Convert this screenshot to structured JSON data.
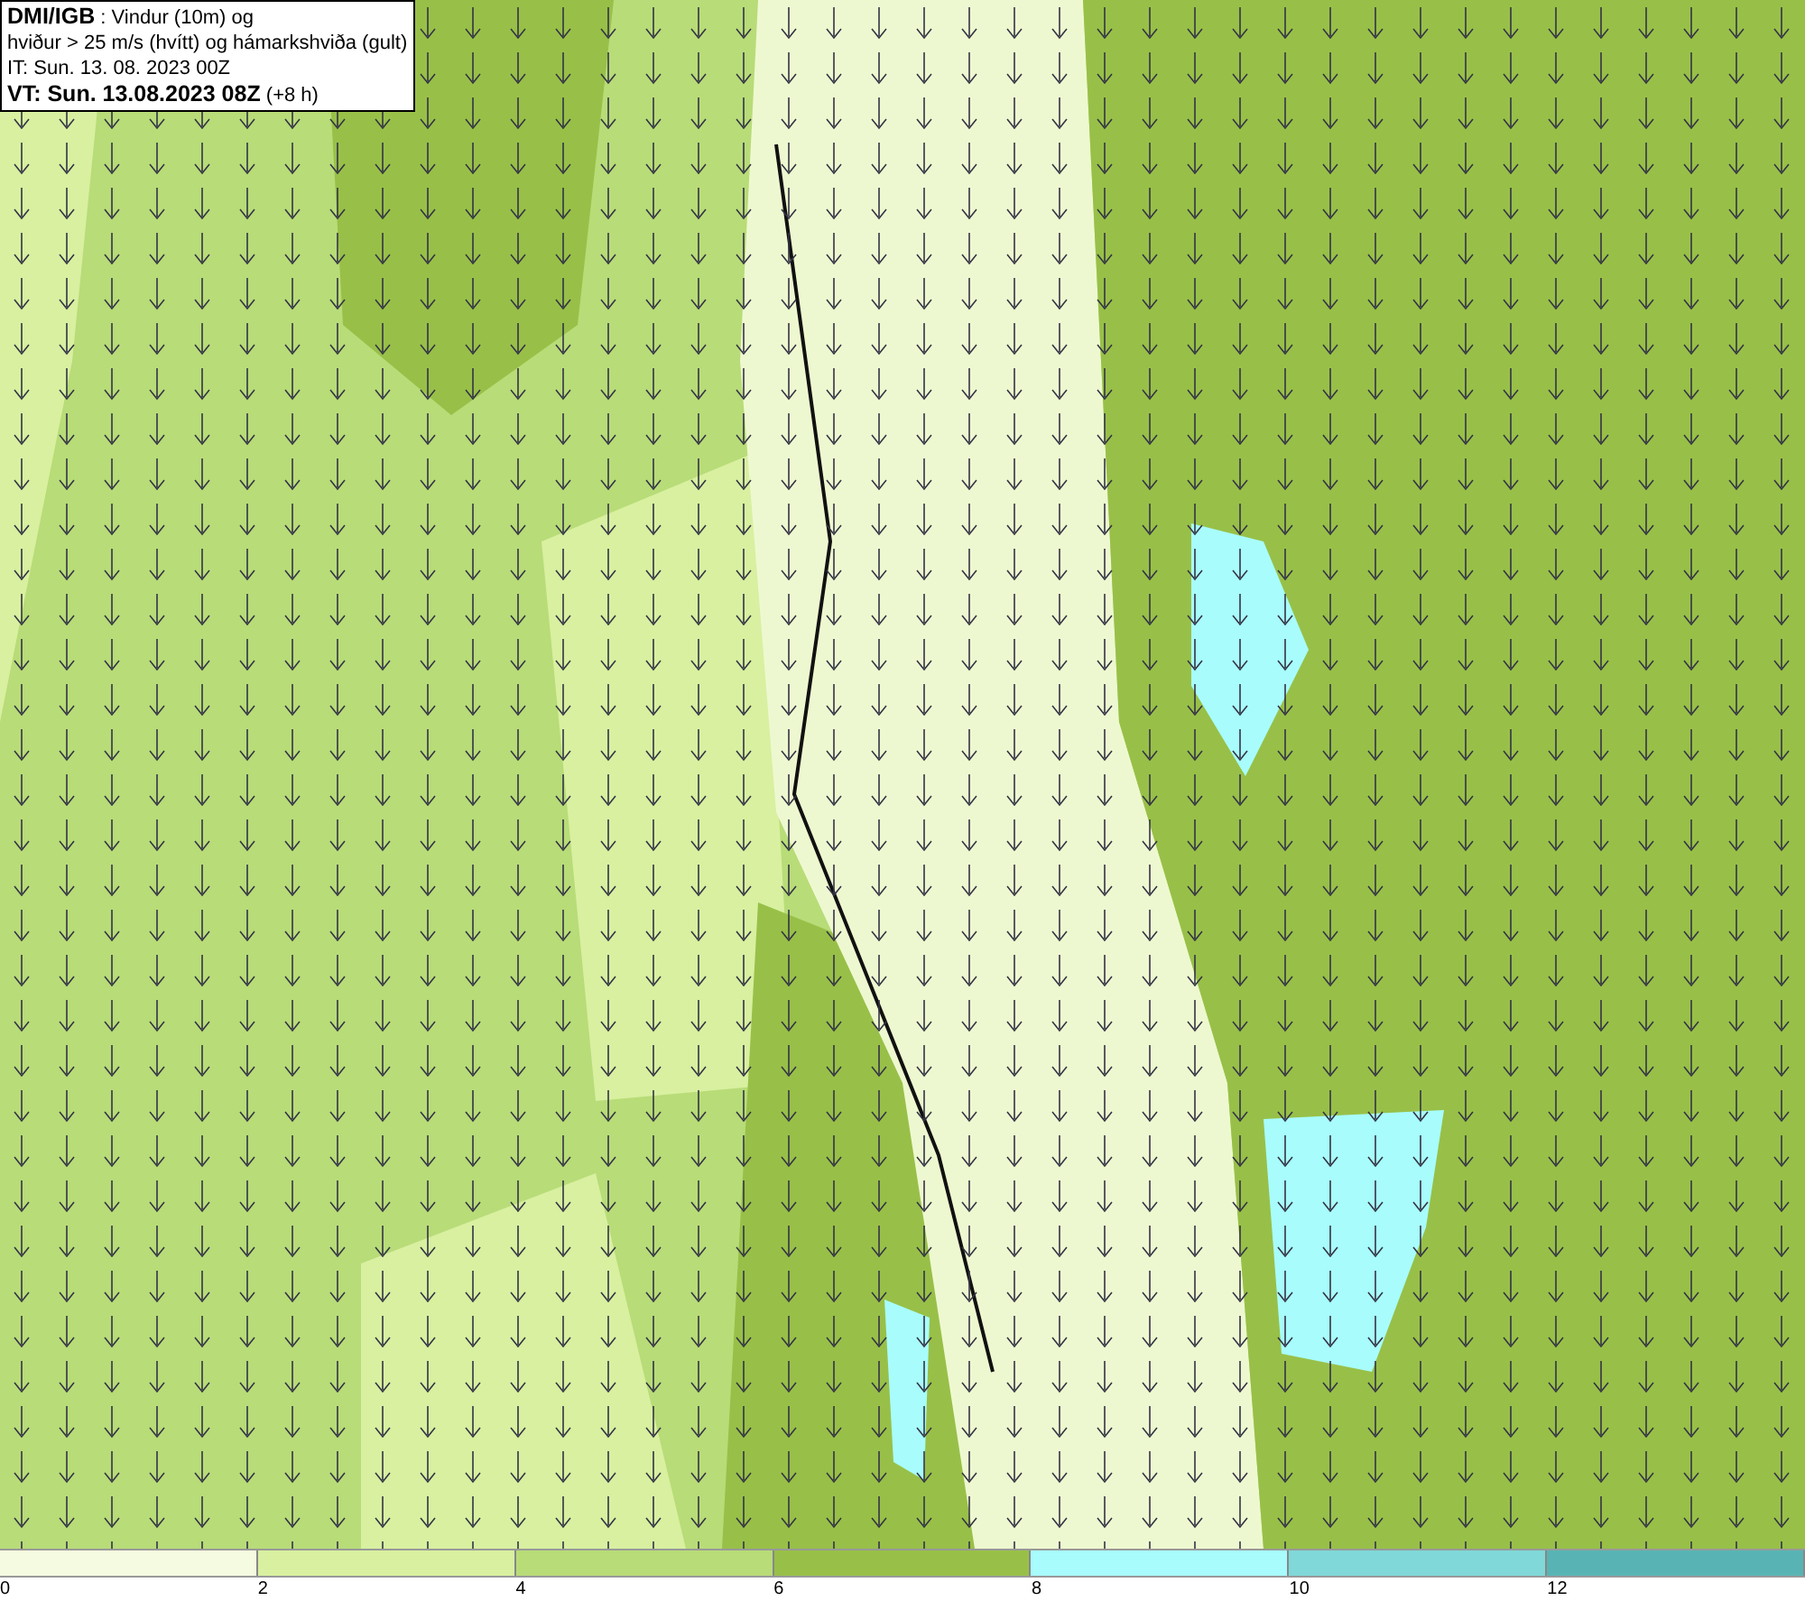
{
  "info_box": {
    "lines": [
      "**DMI/IGB** : Vindur (10m) og",
      "hviður > 25 m/s (hvítt) og hámarkshviða (gult)",
      "IT: Sun. 13. 08. 2023 00Z",
      "**VT: Sun. 13.08.2023 08Z** (+8 h)"
    ]
  },
  "legend": [
    {
      "label": "0",
      "color": "#f4fbe0"
    },
    {
      "label": "2",
      "color": "#d8f0a0"
    },
    {
      "label": "4",
      "color": "#b8dc78"
    },
    {
      "label": "6",
      "color": "#98c048"
    },
    {
      "label": "8",
      "color": "#a8fcfc"
    },
    {
      "label": "10",
      "color": "#80d8d8"
    },
    {
      "label": "12",
      "color": "#58b4b4"
    }
  ]
}
